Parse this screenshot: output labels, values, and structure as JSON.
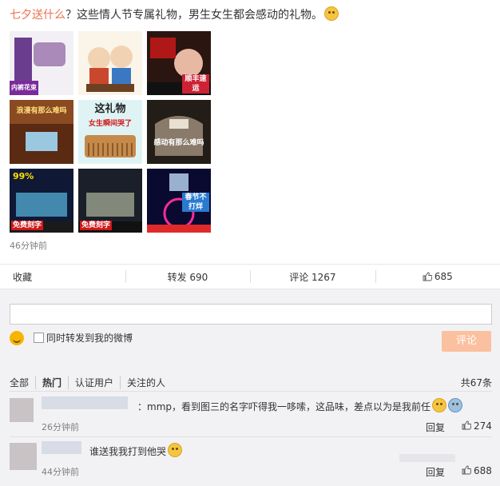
{
  "post": {
    "hashtag": "七夕送什么",
    "text": "？这些情人节专属礼物，男生女生都会感动的礼物。",
    "time": "46分钟前",
    "images": [
      {
        "caption_top": "",
        "caption_bottom": "内裤花束",
        "bg": "#7a4a9a"
      },
      {
        "caption_top": "",
        "caption_bottom": "",
        "bg": "#f4e7d2"
      },
      {
        "caption_top": "",
        "caption_bottom": "顺丰速运",
        "bg": "#3a1a14"
      },
      {
        "caption_top": "浪漫有那么难吗",
        "caption_bottom": "",
        "bg": "#7a3a1c"
      },
      {
        "caption_top": "这礼物",
        "caption_bottom": "女生瞬间哭了",
        "bg": "#d4f1f4"
      },
      {
        "caption_top": "",
        "caption_bottom": "感动有那么难吗",
        "bg": "#2a2520"
      },
      {
        "caption_top": "99%",
        "caption_bottom": "免费刻字",
        "bg": "#101a3a"
      },
      {
        "caption_top": "",
        "caption_bottom": "免费刻字",
        "bg": "#1a1f2a"
      },
      {
        "caption_top": "",
        "caption_bottom": "春节不打烊",
        "bg": "#0a0a30"
      }
    ]
  },
  "actions": {
    "favorite": "收藏",
    "repost": "转发 690",
    "comment": "评论 1267",
    "like": "685"
  },
  "comment_box": {
    "input_value": "",
    "repost_label": "同时转发到我的微博",
    "submit_label": "评论"
  },
  "filters": {
    "all": "全部",
    "hot": "热门",
    "verified": "认证用户",
    "following": "关注的人",
    "total": "共67条"
  },
  "comments": [
    {
      "text": "：mmp，看到图三的名字吓得我一哆嗦，这品味，差点以为是我前任",
      "time": "26分钟前",
      "reply": "回复",
      "likes": "274"
    },
    {
      "text": "谁送我我打到他哭",
      "time": "44分钟前",
      "reply": "回复",
      "likes": "688"
    }
  ]
}
